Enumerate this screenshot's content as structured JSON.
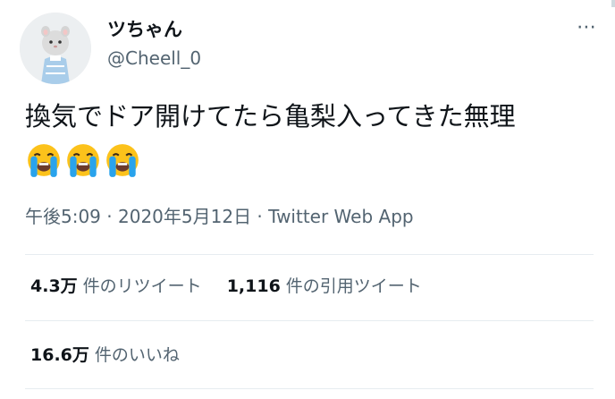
{
  "user": {
    "display_name": "ツちゃん",
    "handle": "@Cheell_0"
  },
  "more_icon": "⋯",
  "tweet": {
    "text": "換気でドア開けてたら亀梨入ってきた無理",
    "emojis": [
      "loudly-crying-face",
      "loudly-crying-face",
      "loudly-crying-face"
    ]
  },
  "meta": {
    "time": "午後5:09",
    "sep1": " · ",
    "date": "2020年5月12日",
    "sep2": " · ",
    "source": "Twitter Web App"
  },
  "stats": {
    "retweets": {
      "count": "4.3万",
      "label": "件のリツイート"
    },
    "quotes": {
      "count": "1,116",
      "label": "件の引用ツイート"
    },
    "likes": {
      "count": "16.6万",
      "label": "件のいいね"
    }
  },
  "colors": {
    "text": "#0f1419",
    "secondary": "#536471",
    "divider": "#e6ecf0",
    "emoji_yellow": "#fcc21b",
    "tear_blue": "#29a3ec"
  }
}
